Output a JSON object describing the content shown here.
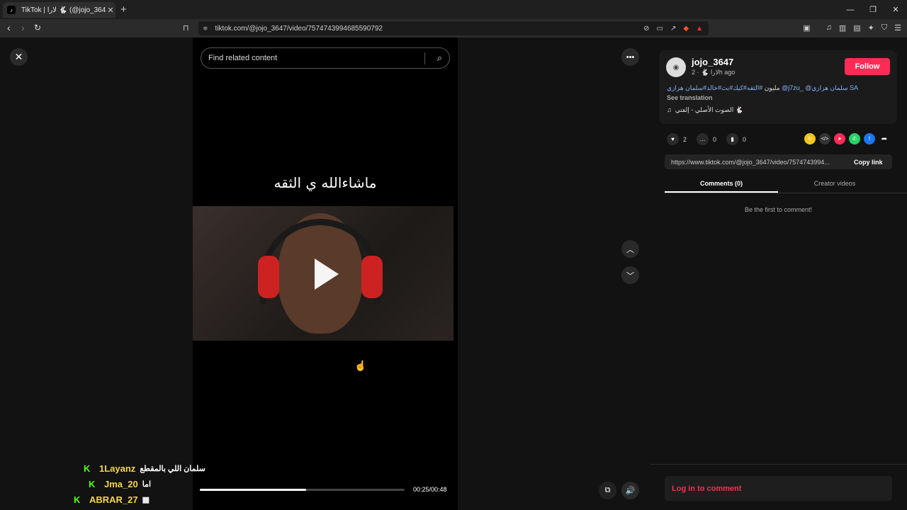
{
  "browser": {
    "tab_title": "TikTok | لارا 🐇 (@jojo_3647)",
    "tab_favicon": "tiktok-icon",
    "url": "tiktok.com/@jojo_3647/video/7574743994685590792"
  },
  "video": {
    "search_placeholder": "Find related content",
    "caption": "ماشاءالله ي الثقه",
    "time": "00:25/00:48",
    "progress": 0.52
  },
  "chat": [
    {
      "user": "1Layanz",
      "message": "سلمان اللي بالمقطع"
    },
    {
      "user": "Jma_20",
      "message": "اما"
    },
    {
      "user": "ABRAR_27",
      "message": ""
    }
  ],
  "post": {
    "username": "jojo_3647",
    "display_name": "لارا 🐇",
    "age": "2h ago",
    "follow_label": "Follow",
    "description_text": "مليون",
    "description_tags": "#الثقه#كيك#بث#خالد#سلمان هزازي",
    "description_mention": "@j7zu_ @سلمان هزازي",
    "description_suffix": "SA",
    "see_translation": "See translation",
    "music": "الصوت الأصلي - إلفتي 🐇",
    "likes": "2",
    "comments": "0",
    "saves": "0",
    "link": "https://www.tiktok.com/@jojo_3647/video/7574743994...",
    "copy_link": "Copy link"
  },
  "tabs": {
    "comments": "Comments (0)",
    "creator_videos": "Creator videos"
  },
  "empty_comments": "Be the first to comment!",
  "login_prompt": "Log in to comment",
  "colors": {
    "accent": "#fe2c55",
    "kick_green": "#53fc18",
    "chat_user": "#f5d54a"
  }
}
